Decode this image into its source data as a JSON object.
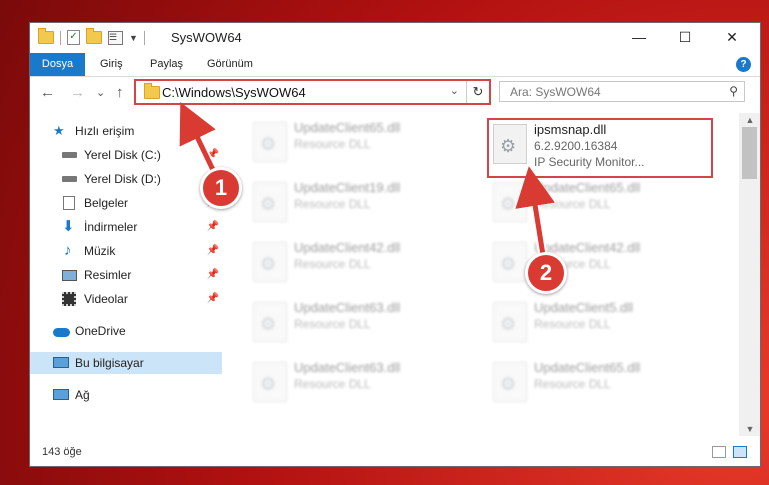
{
  "window": {
    "title": "SysWOW64",
    "minimize": "—",
    "maximize": "☐",
    "close": "✕"
  },
  "ribbon": {
    "tabs": [
      "Dosya",
      "Giriş",
      "Paylaş",
      "Görünüm"
    ],
    "help": "?"
  },
  "nav": {
    "back": "←",
    "forward": "→",
    "recent": "⌄",
    "up": "↑",
    "address": "C:\\Windows\\SysWOW64",
    "address_dropdown": "⌄",
    "refresh": "↻",
    "search_placeholder": "Ara: SysWOW64",
    "search_icon": "⚲"
  },
  "sidebar": {
    "items": [
      {
        "label": "Hızlı erişim",
        "icon": "star-icon",
        "pinned": false
      },
      {
        "label": "Yerel Disk (C:)",
        "icon": "drive-icon",
        "pinned": true
      },
      {
        "label": "Yerel Disk (D:)",
        "icon": "drive-icon",
        "pinned": true
      },
      {
        "label": "Belgeler",
        "icon": "documents-icon",
        "pinned": true
      },
      {
        "label": "İndirmeler",
        "icon": "download-icon",
        "pinned": true
      },
      {
        "label": "Müzik",
        "icon": "music-icon",
        "pinned": true
      },
      {
        "label": "Resimler",
        "icon": "pictures-icon",
        "pinned": true
      },
      {
        "label": "Videolar",
        "icon": "video-icon",
        "pinned": true
      },
      {
        "label": "OneDrive",
        "icon": "cloud-icon",
        "pinned": false
      },
      {
        "label": "Bu bilgisayar",
        "icon": "computer-icon",
        "pinned": false
      },
      {
        "label": "Ağ",
        "icon": "network-icon",
        "pinned": false
      }
    ],
    "pin_glyph": "📌"
  },
  "files": {
    "left": [
      {
        "name": "UpdateClient65.dll",
        "desc": "Resource DLL"
      },
      {
        "name": "UpdateClient19.dll",
        "desc": "Resource DLL"
      },
      {
        "name": "UpdateClient42.dll",
        "desc": "Resource DLL"
      },
      {
        "name": "UpdateClient63.dll",
        "desc": "Resource DLL"
      },
      {
        "name": "UpdateClient63.dll",
        "desc": "Resource DLL"
      }
    ],
    "right": [
      {
        "name": "UpdateClient65.dll",
        "desc": "Resource DLL"
      },
      {
        "name": "UpdateClient42.dll",
        "desc": "Resource DLL"
      },
      {
        "name": "UpdateClient5.dll",
        "desc": "Resource DLL"
      },
      {
        "name": "UpdateClient65.dll",
        "desc": "Resource DLL"
      }
    ],
    "highlighted": {
      "name": "ipsmsnap.dll",
      "version": "6.2.9200.16384",
      "description": "IP Security Monitor..."
    }
  },
  "status": {
    "item_count": "143 öğe"
  },
  "markers": {
    "one": "1",
    "two": "2"
  },
  "colors": {
    "accent": "#1979ca",
    "highlight": "#d64545",
    "marker": "#d93b32",
    "selected": "#cce4f7"
  }
}
